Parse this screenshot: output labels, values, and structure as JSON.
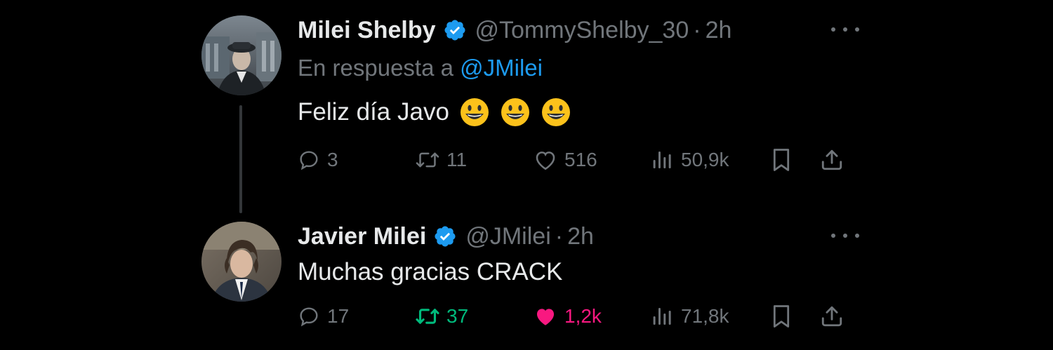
{
  "colors": {
    "background": "#000000",
    "text_primary": "#e7e9ea",
    "text_secondary": "#71767b",
    "link": "#1d9bf0",
    "verified_badge": "#1d9bf0",
    "retweet_active": "#00ba7c",
    "like_active": "#f91880",
    "thread_line": "#333639"
  },
  "tweets": [
    {
      "display_name": "Milei Shelby",
      "verified": true,
      "handle": "@TommyShelby_30",
      "separator": "·",
      "time": "2h",
      "reply_prefix": "En respuesta a",
      "reply_mention": "@JMilei",
      "text": "Feliz día Javo",
      "emojis": [
        "smiley-icon",
        "smiley-icon",
        "smiley-icon"
      ],
      "avatar_icon": "avatar-man-cap-icon",
      "stats": {
        "replies": "3",
        "retweets": "11",
        "likes": "516",
        "views": "50,9k"
      },
      "retweeted": false,
      "liked": false
    },
    {
      "display_name": "Javier Milei",
      "verified": true,
      "handle": "@JMilei",
      "separator": "·",
      "time": "2h",
      "text": "Muchas gracias CRACK",
      "avatar_icon": "avatar-man-suit-icon",
      "stats": {
        "replies": "17",
        "retweets": "37",
        "likes": "1,2k",
        "views": "71,8k"
      },
      "retweeted": true,
      "liked": true
    }
  ]
}
